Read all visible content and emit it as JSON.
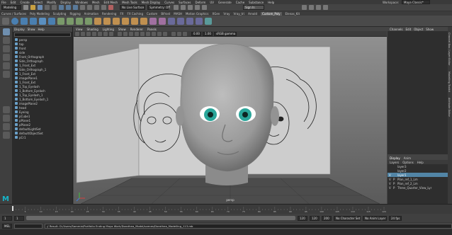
{
  "menubar": [
    "File",
    "Edit",
    "Create",
    "Select",
    "Modify",
    "Display",
    "Windows",
    "Mesh",
    "Edit Mesh",
    "Mesh Tools",
    "Mesh Display",
    "Curves",
    "Surfaces",
    "Deform",
    "UV",
    "Generate",
    "Cache",
    "Substance",
    "Help"
  ],
  "workspace_label": "Workspace:",
  "workspace_value": "Maya Classic*",
  "menuset": "Modeling",
  "live_surface": "No Live Surface",
  "symmetry": "Symmetry: Off",
  "signin": "Sign In",
  "shelf_tabs": [
    "Curves / Surfaces",
    "Poly Modeling",
    "Sculpting",
    "Rigging",
    "Animation",
    "Rendering",
    "FX",
    "FX Caching",
    "Custom",
    "Bifrost",
    "MASH",
    "Motion Graphics",
    "XGen",
    "Vray",
    "Vray_tri",
    "Arnold",
    "Custom_Poly",
    "Elenas_Kit"
  ],
  "shelf_active": "Custom_Poly",
  "outliner": {
    "menu": [
      "Display",
      "Show",
      "Help"
    ],
    "items": [
      "persp",
      "top",
      "front",
      "side",
      "Front_Orthograph",
      "Side_Orthograph",
      "1_Front_Ext",
      "Side_Orthograph_1",
      "1_Front_Ext",
      "imagePlane1",
      "1_Front_Ext",
      "1_Top_Eyelash",
      "1_Bottom_Eyelash",
      "1_Top_Eyelash_1",
      "1_Bottom_Eyelash_1",
      "imagePlane2",
      "head",
      "Eyeing",
      "pCube1",
      "pPlane1",
      "pPlane2",
      "defaultLightSet",
      "defaultObjectSet",
      "pCr1"
    ]
  },
  "viewport": {
    "menu": [
      "View",
      "Shading",
      "Lighting",
      "Show",
      "Renderer",
      "Panels"
    ],
    "num1": "0.00",
    "num2": "1.00",
    "colorspace": "sRGB gamma",
    "camera": "persp"
  },
  "channelbox": {
    "tabs": [
      "Channels",
      "Edit",
      "Object",
      "Show"
    ]
  },
  "layers": {
    "tabs": [
      "Display",
      "Anim"
    ],
    "menu": [
      "Layers",
      "Options",
      "Help"
    ],
    "rows": [
      {
        "v": "",
        "p": "",
        "name": "layer3",
        "sel": false
      },
      {
        "v": "",
        "p": "",
        "name": "layer2",
        "sel": false
      },
      {
        "v": "V",
        "p": "",
        "name": "layer1",
        "sel": true
      },
      {
        "v": "V",
        "p": "P",
        "name": "Plan_ref_1_Lm",
        "sel": false
      },
      {
        "v": "V",
        "p": "P",
        "name": "Plan_ref_2_Lm",
        "sel": false
      },
      {
        "v": "V",
        "p": "P",
        "name": "Three_Quarter_View_Lyr",
        "sel": false
      }
    ]
  },
  "side_tabs": [
    "Channel Box / Layer Editor",
    "Modelling Toolkit",
    "Attribute Editor"
  ],
  "timeline": {
    "start": 1,
    "end": 120,
    "current": 1,
    "ticks": [
      5,
      10,
      15,
      20,
      25,
      30,
      35,
      40,
      45,
      50,
      55,
      60,
      65,
      70,
      75,
      80,
      85,
      90,
      95,
      100,
      105,
      110,
      115,
      120
    ]
  },
  "range": {
    "start_frame": "1",
    "range_start": "1",
    "range_end": "120",
    "end_frame": "120",
    "end_frame_2": "200",
    "no_char_set": "No Character Set",
    "no_anim_layer": "No Anim Layer",
    "fps": "24 fps"
  },
  "cmd": {
    "lang": "MEL",
    "result": "// Result: D:/Users/Sammie/Portfolio Ending Maya Work/Dorothea_Model/scenes/Dorothea_Modelling_113.mb"
  },
  "logo": "M",
  "colors": {
    "accent": "#5285a6",
    "brand": "#16b4c9",
    "eye": "#2aa69a",
    "viewbg": "#8a8a8a",
    "panel": "#c9c9c9"
  }
}
